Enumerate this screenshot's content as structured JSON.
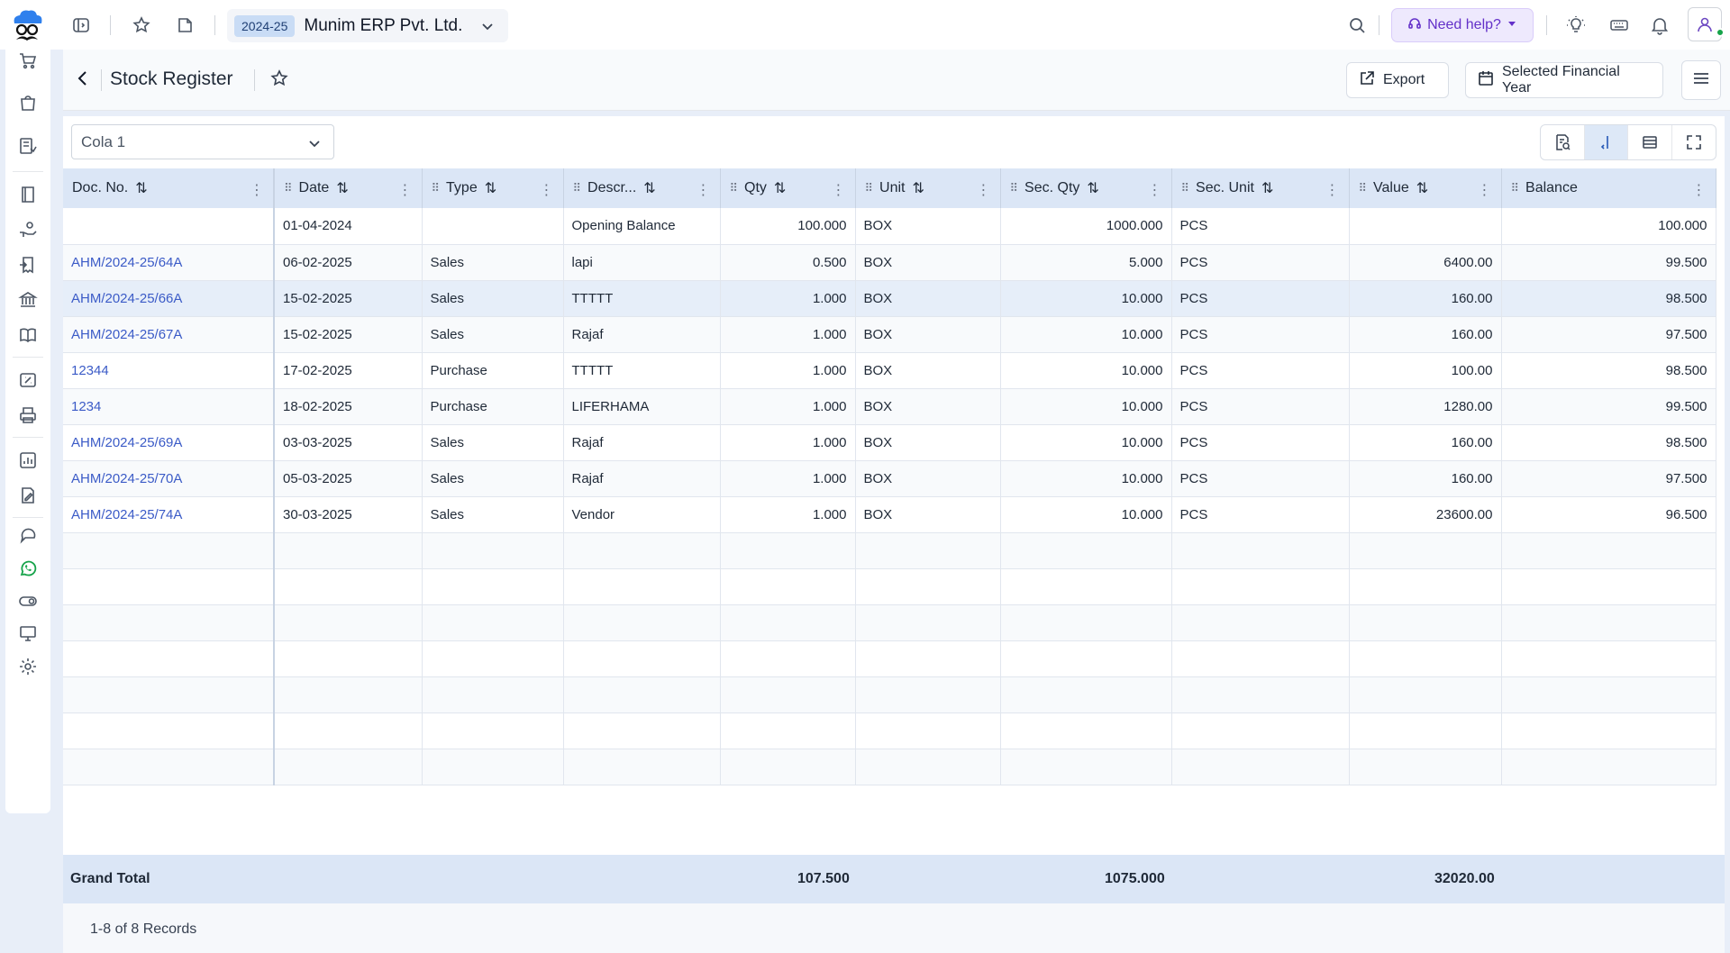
{
  "topbar": {
    "financial_year": "2024-25",
    "company_name": "Munim ERP Pvt. Ltd.",
    "help_label": "Need help?"
  },
  "page": {
    "title": "Stock Register",
    "export_label": "Export",
    "fy_button_label": "Selected Financial Year"
  },
  "filter": {
    "selected_item": "Cola 1"
  },
  "columns": [
    "Doc. No.",
    "Date",
    "Type",
    "Descr...",
    "Qty",
    "Unit",
    "Sec. Qty",
    "Sec. Unit",
    "Value",
    "Balance"
  ],
  "rows": [
    {
      "doc": "",
      "date": "01-04-2024",
      "type": "",
      "desc": "Opening Balance",
      "qty": "100.000",
      "unit": "BOX",
      "sec_qty": "1000.000",
      "sec_unit": "PCS",
      "value": "",
      "balance": "100.000"
    },
    {
      "doc": "AHM/2024-25/64A",
      "date": "06-02-2025",
      "type": "Sales",
      "desc": "lapi",
      "qty": "0.500",
      "unit": "BOX",
      "sec_qty": "5.000",
      "sec_unit": "PCS",
      "value": "6400.00",
      "balance": "99.500"
    },
    {
      "doc": "AHM/2024-25/66A",
      "date": "15-02-2025",
      "type": "Sales",
      "desc": "TTTTT",
      "qty": "1.000",
      "unit": "BOX",
      "sec_qty": "10.000",
      "sec_unit": "PCS",
      "value": "160.00",
      "balance": "98.500"
    },
    {
      "doc": "AHM/2024-25/67A",
      "date": "15-02-2025",
      "type": "Sales",
      "desc": "Rajaf",
      "qty": "1.000",
      "unit": "BOX",
      "sec_qty": "10.000",
      "sec_unit": "PCS",
      "value": "160.00",
      "balance": "97.500"
    },
    {
      "doc": "12344",
      "date": "17-02-2025",
      "type": "Purchase",
      "desc": "TTTTT",
      "qty": "1.000",
      "unit": "BOX",
      "sec_qty": "10.000",
      "sec_unit": "PCS",
      "value": "100.00",
      "balance": "98.500"
    },
    {
      "doc": "1234",
      "date": "18-02-2025",
      "type": "Purchase",
      "desc": "LIFERHAMA",
      "qty": "1.000",
      "unit": "BOX",
      "sec_qty": "10.000",
      "sec_unit": "PCS",
      "value": "1280.00",
      "balance": "99.500"
    },
    {
      "doc": "AHM/2024-25/69A",
      "date": "03-03-2025",
      "type": "Sales",
      "desc": "Rajaf",
      "qty": "1.000",
      "unit": "BOX",
      "sec_qty": "10.000",
      "sec_unit": "PCS",
      "value": "160.00",
      "balance": "98.500"
    },
    {
      "doc": "AHM/2024-25/70A",
      "date": "05-03-2025",
      "type": "Sales",
      "desc": "Rajaf",
      "qty": "1.000",
      "unit": "BOX",
      "sec_qty": "10.000",
      "sec_unit": "PCS",
      "value": "160.00",
      "balance": "97.500"
    },
    {
      "doc": "AHM/2024-25/74A",
      "date": "30-03-2025",
      "type": "Sales",
      "desc": "Vendor",
      "qty": "1.000",
      "unit": "BOX",
      "sec_qty": "10.000",
      "sec_unit": "PCS",
      "value": "23600.00",
      "balance": "96.500"
    }
  ],
  "totals": {
    "label": "Grand Total",
    "qty": "107.500",
    "sec_qty": "1075.000",
    "value": "32020.00"
  },
  "pagination": {
    "records_text": "1-8 of 8 Records"
  },
  "colors": {
    "accent": "#3b5bc7",
    "header_bg": "#dbe6f6",
    "help_purple": "#6330c9"
  }
}
